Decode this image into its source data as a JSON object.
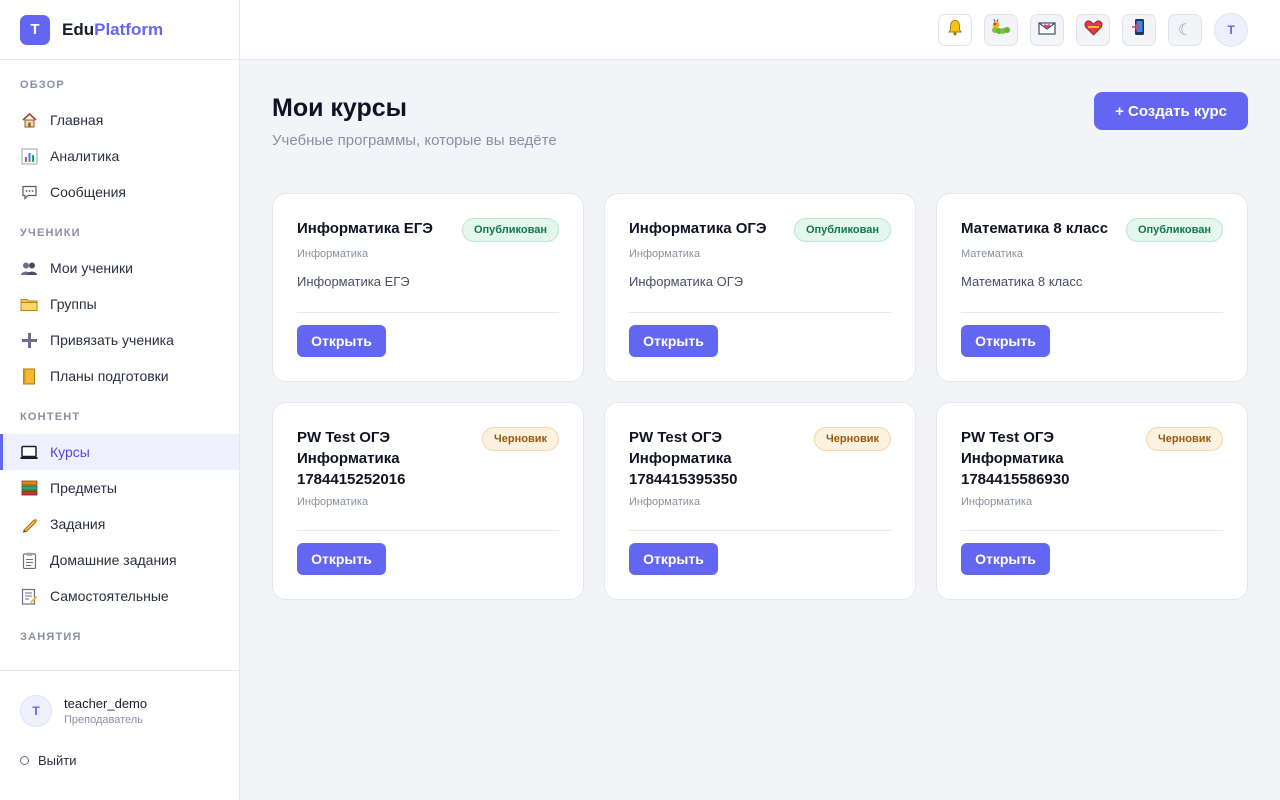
{
  "brand": {
    "logo_letter": "T",
    "name_part1": "Edu",
    "name_part2": "Platform",
    "accent_color": "#6366f1"
  },
  "sidebar": {
    "sections": [
      {
        "label": "ОБЗОР",
        "items": [
          {
            "label": "Главная",
            "icon": "house-icon"
          },
          {
            "label": "Аналитика",
            "icon": "bar-chart-icon"
          },
          {
            "label": "Сообщения",
            "icon": "speech-bubble-icon"
          }
        ]
      },
      {
        "label": "УЧЕНИКИ",
        "items": [
          {
            "label": "Мои ученики",
            "icon": "users-icon"
          },
          {
            "label": "Группы",
            "icon": "folder-icon"
          },
          {
            "label": "Привязать ученика",
            "icon": "plus-icon"
          },
          {
            "label": "Планы подготовки",
            "icon": "notebook-icon"
          }
        ]
      },
      {
        "label": "КОНТЕНТ",
        "items": [
          {
            "label": "Курсы",
            "icon": "laptop-icon",
            "active": true
          },
          {
            "label": "Предметы",
            "icon": "books-icon"
          },
          {
            "label": "Задания",
            "icon": "pencil-icon"
          },
          {
            "label": "Домашние задания",
            "icon": "clipboard-icon"
          },
          {
            "label": "Самостоятельные",
            "icon": "memo-icon"
          }
        ]
      },
      {
        "label": "ЗАНЯТИЯ",
        "items": []
      }
    ]
  },
  "user": {
    "avatar_letter": "T",
    "name": "teacher_demo",
    "role": "Преподаватель",
    "logout_label": "Выйти"
  },
  "topbar": {
    "icons": [
      "bell-icon",
      "caterpillar-icon",
      "envelope-heart-icon",
      "heart-icon",
      "phone-exit-icon",
      "moon-icon"
    ],
    "moon_glyph": "☾",
    "avatar_letter": "T"
  },
  "page": {
    "title": "Мои курсы",
    "subtitle": "Учебные программы, которые вы ведёте",
    "create_label": "+ Создать курс"
  },
  "courses": [
    {
      "title": "Информатика ЕГЭ",
      "status": "Опубликован",
      "status_kind": "published",
      "subject": "Информатика",
      "description": "Информатика ЕГЭ",
      "open_label": "Открыть"
    },
    {
      "title": "Информатика ОГЭ",
      "status": "Опубликован",
      "status_kind": "published",
      "subject": "Информатика",
      "description": "Информатика ОГЭ",
      "open_label": "Открыть"
    },
    {
      "title": "Математика 8 класс",
      "status": "Опубликован",
      "status_kind": "published",
      "subject": "Математика",
      "description": "Математика 8 класс",
      "open_label": "Открыть"
    },
    {
      "title": "PW Test ОГЭ Информатика 1784415252016",
      "status": "Черновик",
      "status_kind": "draft",
      "subject": "Информатика",
      "description": "",
      "open_label": "Открыть"
    },
    {
      "title": "PW Test ОГЭ Информатика 1784415395350",
      "status": "Черновик",
      "status_kind": "draft",
      "subject": "Информатика",
      "description": "",
      "open_label": "Открыть"
    },
    {
      "title": "PW Test ОГЭ Информатика 1784415586930",
      "status": "Черновик",
      "status_kind": "draft",
      "subject": "Информатика",
      "description": "",
      "open_label": "Открыть"
    }
  ]
}
